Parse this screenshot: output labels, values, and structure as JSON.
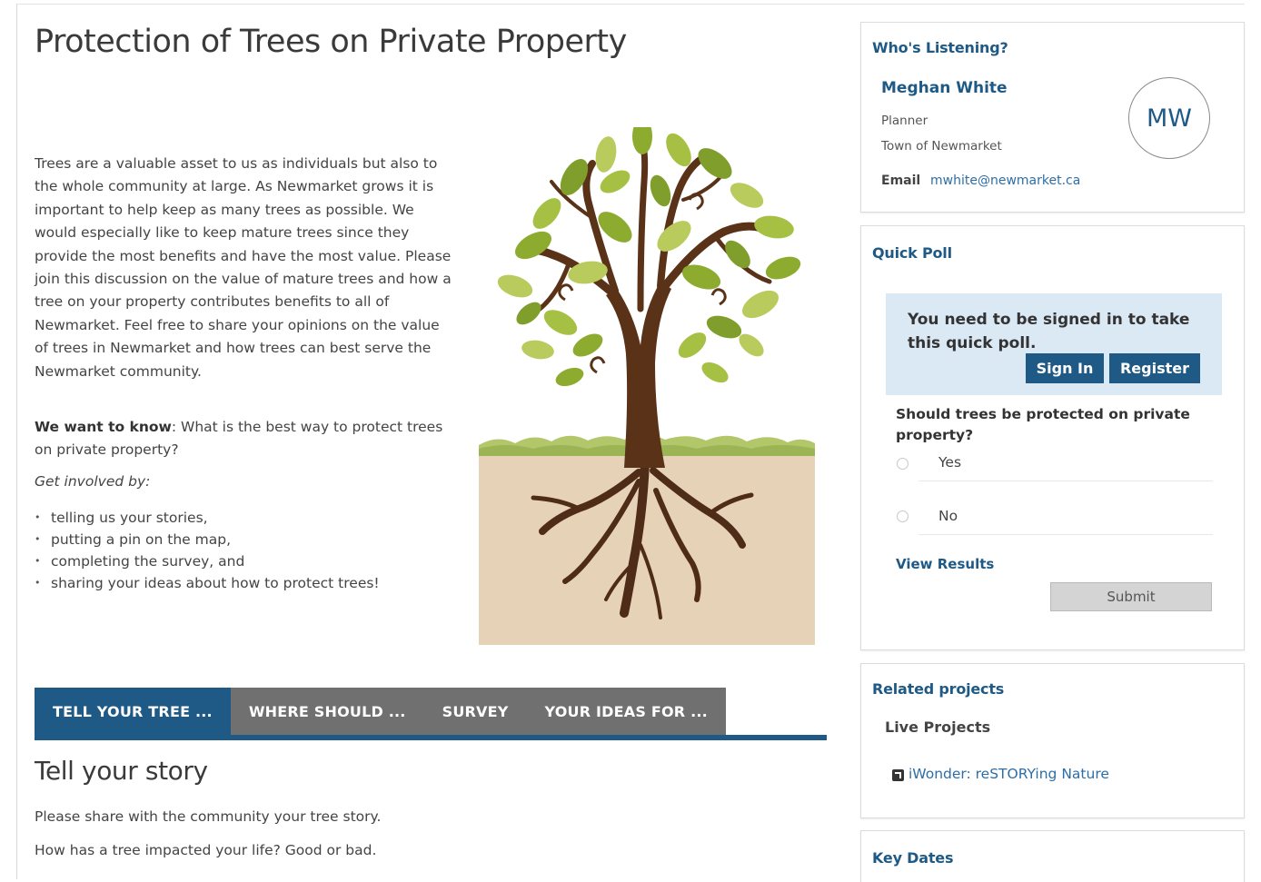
{
  "page": {
    "title": "Protection of Trees on Private Property",
    "intro": "Trees are a valuable asset to us as individuals but also to the whole community at large. As Newmarket grows it is important to help keep as many trees as possible. We would especially like to keep mature trees since they provide the most benefits and have the most value. Please join this discussion on the value of mature trees and how a tree on your property contributes benefits to all of Newmarket. Feel free to share your opinions on the value of trees in Newmarket and how trees can best serve the Newmarket community.",
    "want_label": "We want to know",
    "want_text": ": What is the best way to protect trees on private property?",
    "get_involved": "Get involved by:",
    "bullets": [
      "telling us your stories,",
      "putting a pin on the map,",
      "completing the survey, and",
      "sharing your ideas about how to protect trees!"
    ],
    "illustration_icon": "tree-illustration"
  },
  "tabs": [
    {
      "label": "TELL YOUR TREE ...",
      "active": true
    },
    {
      "label": "WHERE SHOULD ...",
      "active": false
    },
    {
      "label": "SURVEY",
      "active": false
    },
    {
      "label": "YOUR IDEAS FOR ...",
      "active": false
    }
  ],
  "section": {
    "title": "Tell your story",
    "para1": "Please share with the community your tree story.",
    "para2": "How has a tree impacted your life? Good or bad."
  },
  "listening": {
    "title": "Who's Listening?",
    "name": "Meghan White",
    "role": "Planner",
    "org": "Town of Newmarket",
    "email_label": "Email",
    "email": "mwhite@newmarket.ca",
    "initials": "MW"
  },
  "poll": {
    "title": "Quick Poll",
    "signin_message": "You need to be signed in to take this quick poll.",
    "signin_label": "Sign In",
    "register_label": "Register",
    "question": "Should trees be protected on private property?",
    "options": [
      "Yes",
      "No"
    ],
    "view_results": "View Results",
    "submit_label": "Submit"
  },
  "related": {
    "title": "Related projects",
    "live_title": "Live Projects",
    "project": "iWonder: reSTORYing Nature"
  },
  "dates": {
    "title": "Key Dates"
  },
  "colors": {
    "primary": "#1f5a86",
    "tab_inactive": "#707070",
    "signin_bg": "#dbe9f5",
    "link": "#2e6ea6"
  }
}
